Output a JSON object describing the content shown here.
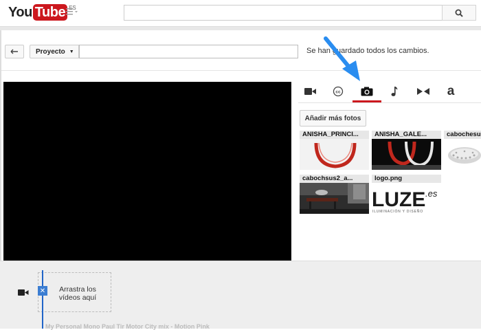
{
  "masthead": {
    "logo_you": "You",
    "logo_tube": "Tube",
    "logo_region": "ES",
    "guide_icon": "menu-icon",
    "search_value": "",
    "search_icon": "search-icon"
  },
  "project_bar": {
    "back_icon": "back-arrow-icon",
    "project_label": "Proyecto",
    "project_title_value": "",
    "save_status": "Se han guardado todos los cambios."
  },
  "tools": {
    "tabs": [
      {
        "name": "video",
        "icon": "video-camera-icon"
      },
      {
        "name": "captions",
        "icon": "cc-icon"
      },
      {
        "name": "photos",
        "icon": "camera-icon",
        "active": true
      },
      {
        "name": "audio",
        "icon": "music-note-icon"
      },
      {
        "name": "transitions",
        "icon": "transition-icon"
      },
      {
        "name": "text",
        "icon": "text-icon",
        "label": "a"
      }
    ],
    "accent_color": "#cc181e",
    "pointer_color": "#2a8df0"
  },
  "photos": {
    "add_button": "Añadir más fotos",
    "items": [
      {
        "name": "ANISHA_PRINCI..."
      },
      {
        "name": "ANISHA_GALE..."
      },
      {
        "name": "cabochesu"
      },
      {
        "name": "cabochsus2_a..."
      },
      {
        "name": "logo.png",
        "logo_text": "LUZE",
        "logo_suffix": ".es",
        "logo_tagline": "ILUMINACIÓN Y DISEÑO"
      }
    ]
  },
  "timeline": {
    "track_icon": "video-camera-icon",
    "drop_icon": "close-icon",
    "drop_text": "Arrastra los vídeos aquí",
    "audio_track": "My Personal Mono Paul Tir Motor City mix - Motion Pink"
  }
}
